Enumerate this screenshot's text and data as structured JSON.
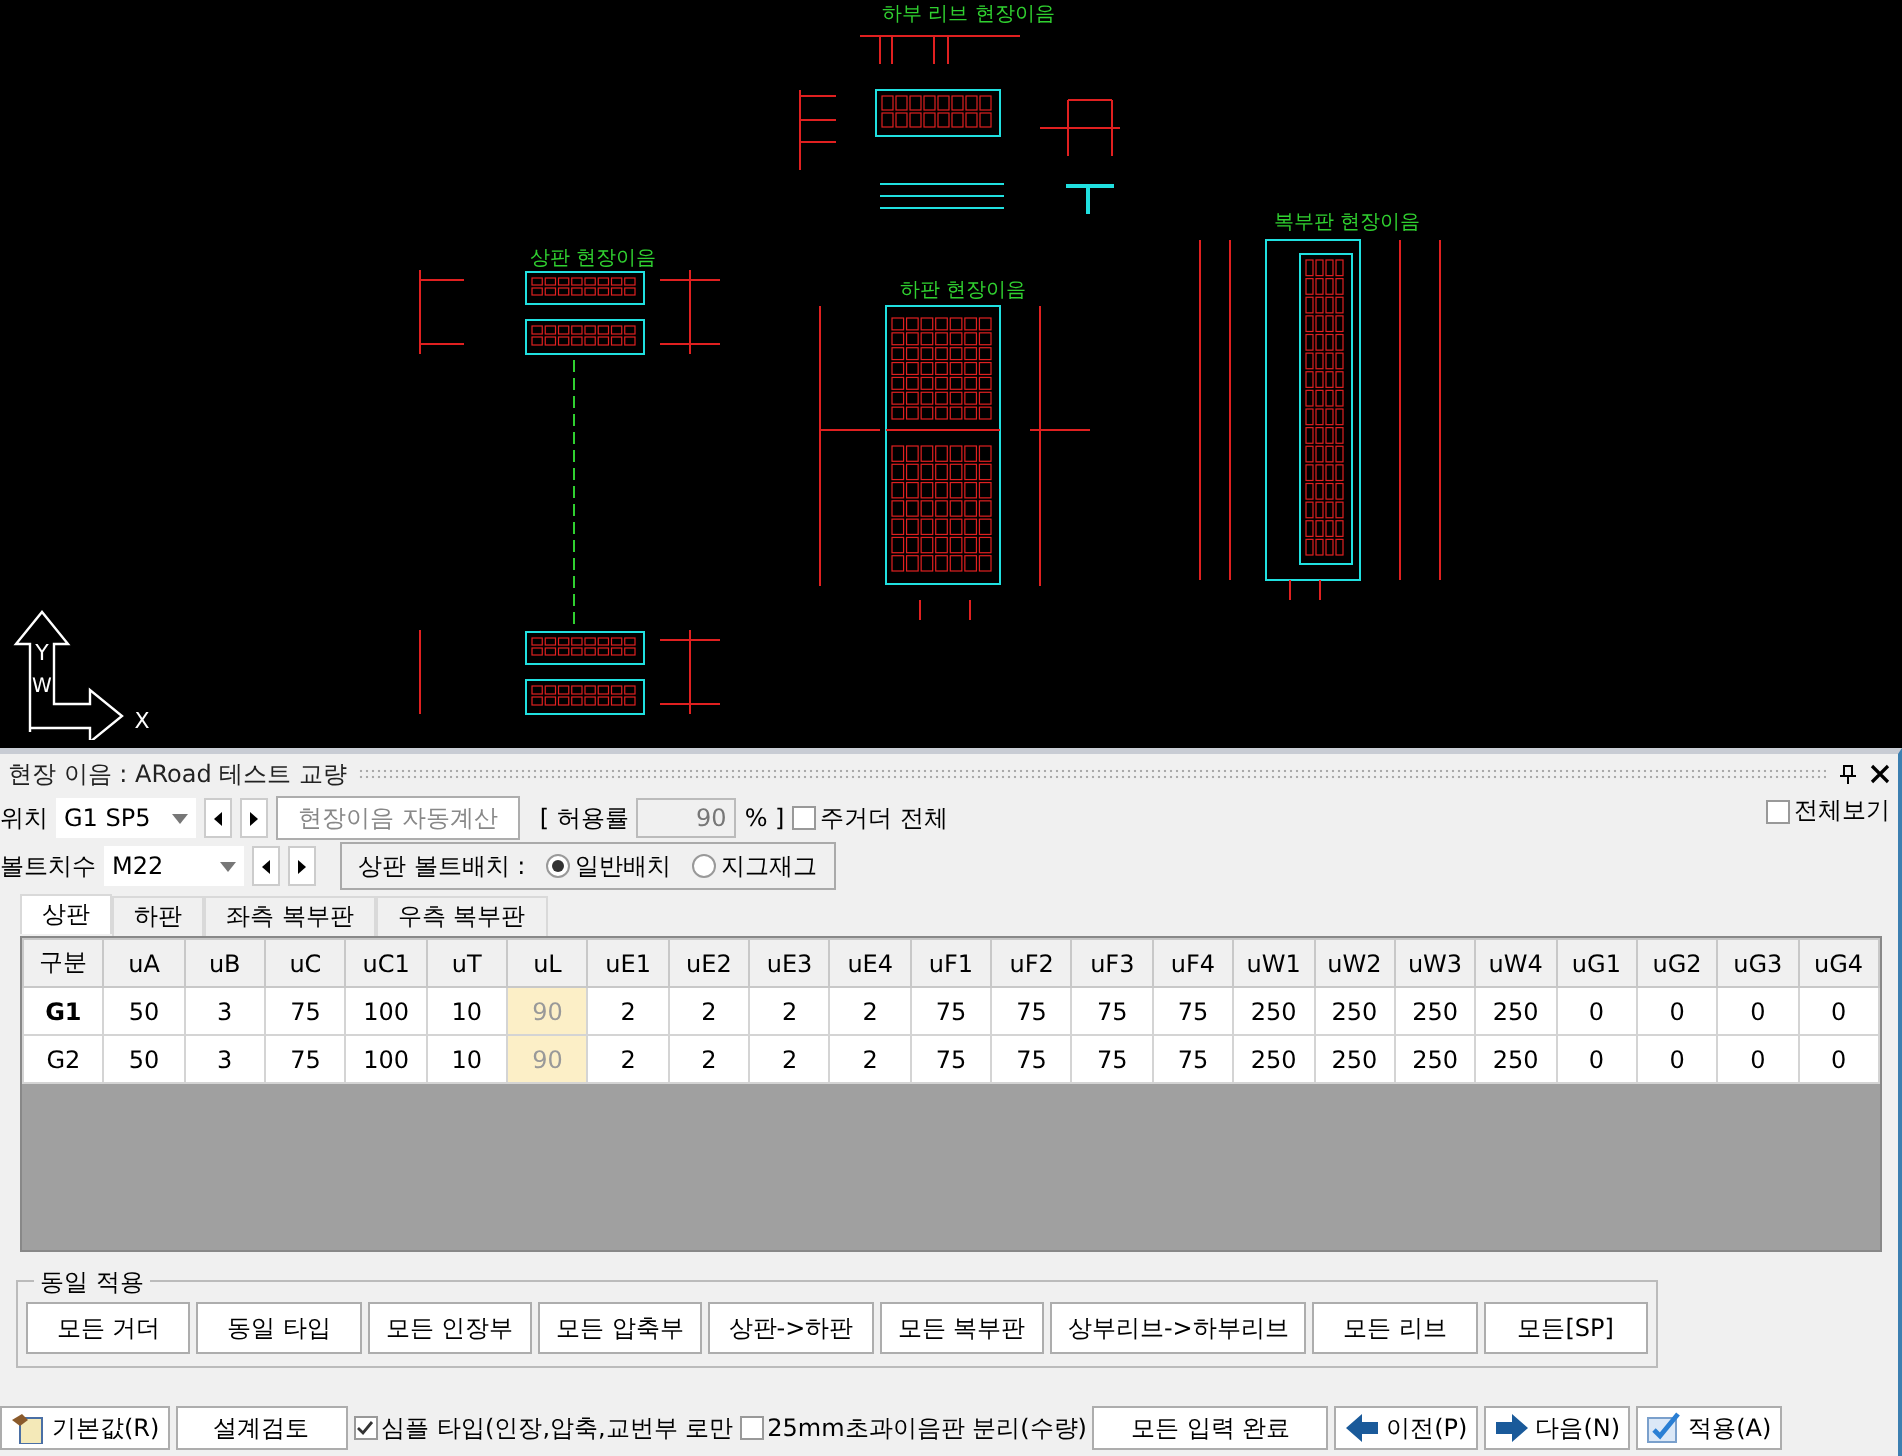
{
  "canvas": {
    "labels": [
      "하부 리브 현장이음",
      "상판 현장이음",
      "하판 현장이음",
      "복부판 현장이음"
    ],
    "ucs": {
      "y": "Y",
      "w": "W",
      "x": "X"
    }
  },
  "panel": {
    "title": "현장 이음 : ARoad 테스트 교량"
  },
  "controls": {
    "position": {
      "label": "위치",
      "value": "G1 SP5"
    },
    "auto_calc": {
      "label": "현장이음 자동계산",
      "disabled": true
    },
    "tolerance": {
      "label_open": "[ 허용률",
      "value": "90",
      "label_close": "% ]",
      "disabled": true
    },
    "all_girders": {
      "label": "주거더 전체",
      "checked": false
    },
    "view_all": {
      "label": "전체보기",
      "checked": false
    },
    "bolt_size": {
      "label": "볼트치수",
      "value": "M22"
    },
    "bolt_layout": {
      "label": "상판 볼트배치 :",
      "options": [
        {
          "label": "일반배치",
          "selected": true
        },
        {
          "label": "지그재그",
          "selected": false
        }
      ]
    }
  },
  "tabs": [
    {
      "label": "상판",
      "selected": true
    },
    {
      "label": "하판",
      "selected": false
    },
    {
      "label": "좌측 복부판",
      "selected": false
    },
    {
      "label": "우측 복부판",
      "selected": false
    }
  ],
  "table": {
    "columns": [
      {
        "label": "구분",
        "highlighted": false
      },
      {
        "label": "uA",
        "highlighted": false
      },
      {
        "label": "uB",
        "highlighted": false
      },
      {
        "label": "uC",
        "highlighted": false
      },
      {
        "label": "uC1",
        "highlighted": false
      },
      {
        "label": "uT",
        "highlighted": false
      },
      {
        "label": "uL",
        "highlighted": true
      },
      {
        "label": "uE1",
        "highlighted": false
      },
      {
        "label": "uE2",
        "highlighted": false
      },
      {
        "label": "uE3",
        "highlighted": false
      },
      {
        "label": "uE4",
        "highlighted": false
      },
      {
        "label": "uF1",
        "highlighted": false
      },
      {
        "label": "uF2",
        "highlighted": false
      },
      {
        "label": "uF3",
        "highlighted": false
      },
      {
        "label": "uF4",
        "highlighted": false
      },
      {
        "label": "uW1",
        "highlighted": false
      },
      {
        "label": "uW2",
        "highlighted": false
      },
      {
        "label": "uW3",
        "highlighted": false
      },
      {
        "label": "uW4",
        "highlighted": false
      },
      {
        "label": "uG1",
        "highlighted": false
      },
      {
        "label": "uG2",
        "highlighted": false
      },
      {
        "label": "uG3",
        "highlighted": false
      },
      {
        "label": "uG4",
        "highlighted": false
      }
    ],
    "rows": [
      {
        "selected": true,
        "cells": [
          "G1",
          "50",
          "3",
          "75",
          "100",
          "10",
          "90",
          "2",
          "2",
          "2",
          "2",
          "75",
          "75",
          "75",
          "75",
          "250",
          "250",
          "250",
          "250",
          "0",
          "0",
          "0",
          "0"
        ]
      },
      {
        "selected": false,
        "cells": [
          "G2",
          "50",
          "3",
          "75",
          "100",
          "10",
          "90",
          "2",
          "2",
          "2",
          "2",
          "75",
          "75",
          "75",
          "75",
          "250",
          "250",
          "250",
          "250",
          "0",
          "0",
          "0",
          "0"
        ]
      }
    ]
  },
  "apply_group": {
    "title": "동일 적용",
    "buttons": [
      "모든 거더",
      "동일 타입",
      "모든 인장부",
      "모든 압축부",
      "상판->하판",
      "모든 복부판",
      "상부리브->하부리브",
      "모든 리브",
      "모든[SP]"
    ]
  },
  "footer": {
    "items": [
      {
        "kind": "defaults",
        "label": "기본값(R)"
      },
      {
        "kind": "plain",
        "label": "설계검토"
      },
      {
        "kind": "check",
        "label": "심플 타입(인장,압축,교번부 로만",
        "checked": true
      },
      {
        "kind": "check",
        "label": "25mm초과이음판 분리(수량)",
        "checked": false
      },
      {
        "kind": "plain",
        "label": "모든 입력 완료"
      },
      {
        "kind": "prev",
        "label": "이전(P)"
      },
      {
        "kind": "next",
        "label": "다음(N)"
      },
      {
        "kind": "apply",
        "label": "적용(A)"
      }
    ]
  }
}
